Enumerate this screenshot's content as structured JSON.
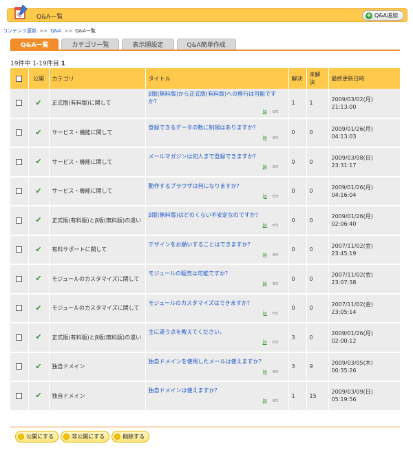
{
  "header": {
    "title": "Q&A一覧",
    "add_button": "Q&A追加"
  },
  "breadcrumb": [
    "コンテンツ更新",
    "Q&A",
    "Q&A一覧"
  ],
  "breadcrumb_sep": ">>",
  "tabs": [
    {
      "label": "Q&A一覧",
      "active": true
    },
    {
      "label": "カテゴリ一覧",
      "active": false
    },
    {
      "label": "表示順設定",
      "active": false
    },
    {
      "label": "Q&A簡単作成",
      "active": false
    }
  ],
  "count": {
    "text": "19件中 1-19件目",
    "page": "1"
  },
  "table": {
    "headers": {
      "publish": "公開",
      "category": "カテゴリ",
      "title": "タイトル",
      "resolved": "解決",
      "unresolved": "未解決",
      "updated": "最終更新日時"
    },
    "rows": [
      {
        "category": "正式版(有料版)に関して",
        "title": "β版(無料版)から正式版(有料版)への移行は可能ですか？",
        "resolved": "1",
        "unresolved": "1",
        "date": "2009/03/02(月)",
        "time": "21:13:00"
      },
      {
        "category": "サービス・機能に関して",
        "title": "登録できるデータの数に制限はありますか？",
        "resolved": "0",
        "unresolved": "0",
        "date": "2009/01/26(月)",
        "time": "04:13:03"
      },
      {
        "category": "サービス・機能に関して",
        "title": "メールマガジンは何人まで登録できますか？",
        "resolved": "0",
        "unresolved": "0",
        "date": "2009/03/08(日)",
        "time": "23:31:17"
      },
      {
        "category": "サービス・機能に関して",
        "title": "動作するブラウザは何になりますか？",
        "resolved": "0",
        "unresolved": "0",
        "date": "2009/01/26(月)",
        "time": "04:16:04"
      },
      {
        "category": "正式版(有料版)とβ版(無料版)の違い",
        "title": "β版(無料版)はどのくらい不安定なのですか？",
        "resolved": "0",
        "unresolved": "0",
        "date": "2009/01/26(月)",
        "time": "02:06:40"
      },
      {
        "category": "有料サポートに関して",
        "title": "デザインをお願いすることはできますか？",
        "resolved": "0",
        "unresolved": "0",
        "date": "2007/11/02(金)",
        "time": "23:45:19"
      },
      {
        "category": "モジュールのカスタマイズに関して",
        "title": "モジュールの販売は可能ですか？",
        "resolved": "0",
        "unresolved": "0",
        "date": "2007/11/02(金)",
        "time": "23:07:38"
      },
      {
        "category": "モジュールのカスタマイズに関して",
        "title": "モジュールのカスタマイズはできますか？",
        "resolved": "0",
        "unresolved": "0",
        "date": "2007/11/02(金)",
        "time": "23:05:14"
      },
      {
        "category": "正式版(有料版)とβ版(無料版)の違い",
        "title": "主に違う点を教えてください。",
        "resolved": "3",
        "unresolved": "0",
        "date": "2009/01/26(月)",
        "time": "02:00:12"
      },
      {
        "category": "独自ドメイン",
        "title": "独自ドメインを使用したメールは使えますか？",
        "resolved": "3",
        "unresolved": "9",
        "date": "2009/03/05(木)",
        "time": "00:35:26"
      },
      {
        "category": "独自ドメイン",
        "title": "独自ドメインは使えますか？",
        "resolved": "1",
        "unresolved": "15",
        "date": "2009/03/09(日)",
        "time": "05:19:56"
      }
    ],
    "lang_ja": "ja",
    "lang_en": "en"
  },
  "actions": [
    "公開にする",
    "非公開にする",
    "削除する"
  ],
  "colors": {
    "accent": "#f38d2a",
    "header": "#ffc94c",
    "link": "#1a56c8"
  }
}
